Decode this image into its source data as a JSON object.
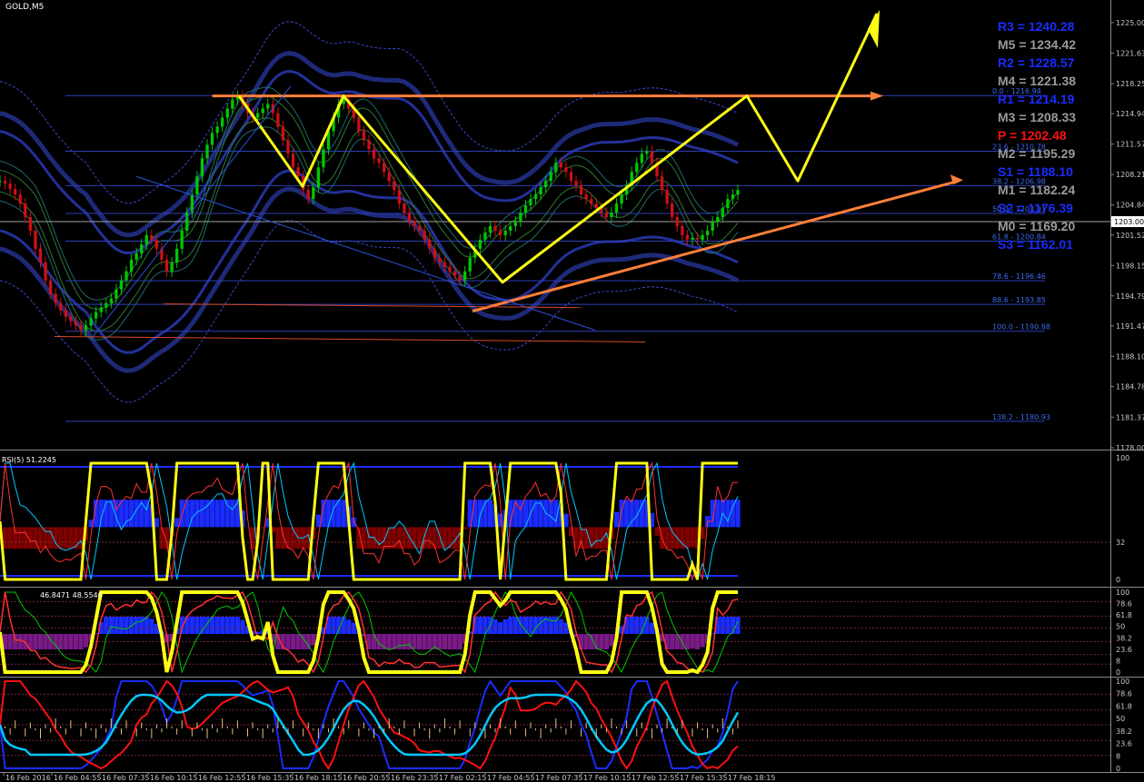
{
  "symbol": "GOLD,M5",
  "main": {
    "price_axis": [
      "1225.00",
      "1221.63",
      "1218.25",
      "1214.94",
      "1211.57",
      "1208.21",
      "1204.84",
      "1201.52",
      "1198.15",
      "1194.79",
      "1191.47",
      "1188.10",
      "1184.78",
      "1181.37",
      "1178.00"
    ],
    "current_price": "1203.00",
    "fib_levels": [
      {
        "label": "0.0 - 1216.94",
        "value": 1216.94
      },
      {
        "label": "23.6 - 1210.78",
        "value": 1210.78
      },
      {
        "label": "38.2 - 1206.98",
        "value": 1206.98
      },
      {
        "label": "50.0 - 1203.91",
        "value": 1203.91
      },
      {
        "label": "61.8 - 1200.84",
        "value": 1200.84
      },
      {
        "label": "78.6 - 1196.46",
        "value": 1196.46
      },
      {
        "label": "88.6 - 1193.85",
        "value": 1193.85
      },
      {
        "label": "100.0 - 1190.88",
        "value": 1190.88
      },
      {
        "label": "138.2 - 1180.93",
        "value": 1180.93
      }
    ],
    "pivots": [
      {
        "label": "R3 = 1240.28",
        "color": "#1a2cff"
      },
      {
        "label": "M5 = 1234.42",
        "color": "#9a9a9a"
      },
      {
        "label": "R2 = 1228.57",
        "color": "#1a2cff"
      },
      {
        "label": "M4 = 1221.38",
        "color": "#9a9a9a"
      },
      {
        "label": "R1 = 1214.19",
        "color": "#1a2cff"
      },
      {
        "label": "M3 = 1208.33",
        "color": "#9a9a9a"
      },
      {
        "label": "P  = 1202.48",
        "color": "#ff1010"
      },
      {
        "label": "M2 = 1195.29",
        "color": "#9a9a9a"
      },
      {
        "label": "S1 = 1188.10",
        "color": "#1a2cff"
      },
      {
        "label": "M1 = 1182.24",
        "color": "#9a9a9a"
      },
      {
        "label": "S2 = 1176.39",
        "color": "#1a2cff"
      },
      {
        "label": "M0 = 1169.20",
        "color": "#9a9a9a"
      },
      {
        "label": "S3 = 1162.01",
        "color": "#1a2cff"
      }
    ]
  },
  "rsi": {
    "label": "RSI(5) 51.2245",
    "axis": [
      "100",
      "32",
      "0"
    ]
  },
  "stoch": {
    "label": "46.8471 48.5540",
    "axis": [
      "100",
      "78.6",
      "61.8",
      "50",
      "38.2",
      "23.6",
      "8",
      "0"
    ]
  },
  "osc": {
    "axis": [
      "100",
      "78.6",
      "61.8",
      "50",
      "38.2",
      "23.6",
      "8",
      "0"
    ]
  },
  "time_axis": [
    "16 Feb 2016",
    "16 Feb 04:55",
    "16 Feb 07:35",
    "16 Feb 10:15",
    "16 Feb 12:55",
    "16 Feb 15:35",
    "16 Feb 18:15",
    "16 Feb 20:55",
    "16 Feb 23:35",
    "17 Feb 02:15",
    "17 Feb 04:55",
    "17 Feb 07:35",
    "17 Feb 10:15",
    "17 Feb 12:55",
    "17 Feb 15:35",
    "17 Feb 18:15"
  ],
  "chart_data": {
    "type": "line",
    "title": "GOLD,M5",
    "xlabel": "",
    "ylabel": "",
    "ylim": [
      1178.0,
      1226.5
    ],
    "x_index_range": [
      0,
      160
    ],
    "series": [
      {
        "values": [
          1207.5,
          1207.2,
          1206.6,
          1206.0,
          1205.0,
          1203.5,
          1202.0,
          1200.0,
          1198.5,
          1196.5,
          1195.0,
          1194.0,
          1193.2,
          1192.5,
          1192.0,
          1191.5,
          1191.0,
          1191.5,
          1192.3,
          1193.0,
          1193.5,
          1194.0,
          1194.5,
          1195.5,
          1196.5,
          1197.5,
          1198.8,
          1199.5,
          1200.5,
          1201.5,
          1201.0,
          1200.0,
          1198.8,
          1197.5,
          1198.5,
          1200.0,
          1202.0,
          1204.0,
          1206.0,
          1208.0,
          1210.0,
          1211.5,
          1212.8,
          1213.5,
          1214.5,
          1215.5,
          1216.5,
          1216.9,
          1216.0,
          1215.0,
          1214.5,
          1215.0,
          1215.5,
          1216.0,
          1215.0,
          1213.5,
          1212.0,
          1210.5,
          1209.0,
          1208.0,
          1206.5,
          1205.5,
          1206.8,
          1209.0,
          1211.0,
          1213.0,
          1214.5,
          1216.0,
          1216.5,
          1215.5,
          1214.5,
          1213.0,
          1212.0,
          1211.0,
          1210.0,
          1209.5,
          1208.5,
          1207.5,
          1206.5,
          1205.0,
          1204.0,
          1203.0,
          1202.5,
          1202.0,
          1201.0,
          1200.0,
          1199.0,
          1198.5,
          1198.0,
          1197.5,
          1197.0,
          1196.5,
          1197.5,
          1199.0,
          1200.0,
          1201.0,
          1201.8,
          1202.5,
          1202.0,
          1201.5,
          1202.0,
          1202.5,
          1203.0,
          1204.0,
          1204.8,
          1205.5,
          1206.0,
          1206.8,
          1207.5,
          1208.5,
          1209.5,
          1209.0,
          1208.5,
          1207.5,
          1207.0,
          1206.0,
          1205.5,
          1205.0,
          1204.5,
          1204.0,
          1203.5,
          1204.0,
          1205.0,
          1206.0,
          1207.0,
          1208.5,
          1209.5,
          1210.5,
          1210.8,
          1209.5,
          1208.0,
          1206.5,
          1205.0,
          1203.5,
          1202.5,
          1201.5,
          1201.0,
          1201.2,
          1201.0,
          1201.5,
          1202.0,
          1203.0,
          1203.5,
          1204.5,
          1205.5,
          1206.0,
          1206.5
        ]
      }
    ]
  }
}
